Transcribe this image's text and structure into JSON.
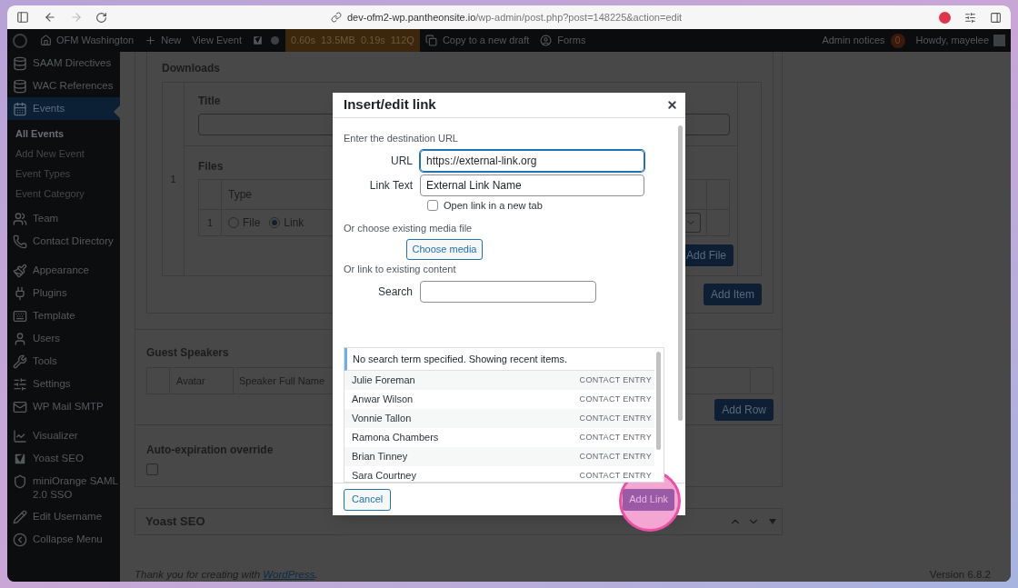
{
  "browser": {
    "url_host": "dev-ofm2-wp.pantheonsite.io",
    "url_path": "/wp-admin/post.php?post=148225&action=edit"
  },
  "admin_bar": {
    "site": "OFM Washington",
    "new": "New",
    "view": "View Event",
    "perf": [
      "0.60s",
      "13.5MB",
      "0.19s",
      "112Q"
    ],
    "copy": "Copy to a new draft",
    "forms": "Forms",
    "notices": {
      "label": "Admin notices",
      "count": "0"
    },
    "howdy": "Howdy, mayelee"
  },
  "sidebar": {
    "groups": [
      [
        {
          "label": "SAAM Directives",
          "selected": false
        },
        {
          "label": "WAC References",
          "selected": false
        },
        {
          "label": "Events",
          "selected": true,
          "children": [
            {
              "label": "All Events",
              "selected": true
            },
            {
              "label": "Add New Event",
              "selected": false
            },
            {
              "label": "Event Types",
              "selected": false
            },
            {
              "label": "Event Category",
              "selected": false
            }
          ]
        },
        {
          "label": "Team",
          "selected": false
        },
        {
          "label": "Contact Directory",
          "selected": false
        }
      ],
      [
        {
          "label": "Appearance",
          "selected": false
        },
        {
          "label": "Plugins",
          "selected": false
        },
        {
          "label": "Template",
          "selected": false
        },
        {
          "label": "Users",
          "selected": false
        },
        {
          "label": "Tools",
          "selected": false
        },
        {
          "label": "Settings",
          "selected": false
        },
        {
          "label": "WP Mail SMTP",
          "selected": false
        }
      ],
      [
        {
          "label": "Visualizer",
          "selected": false
        },
        {
          "label": "Yoast SEO",
          "selected": false
        },
        {
          "label": "miniOrange SAML 2.0 SSO",
          "selected": false
        },
        {
          "label": "Edit Username",
          "selected": false
        },
        {
          "label": "Collapse Menu",
          "selected": false
        }
      ]
    ]
  },
  "downloads": {
    "title": "Downloads",
    "row_number": "1",
    "title_label": "Title",
    "files_label": "Files",
    "files_column": "Type",
    "files_row_number": "1",
    "file_types": [
      {
        "label": "File",
        "selected": false
      },
      {
        "label": "Link",
        "selected": true
      }
    ],
    "add_file": "Add File",
    "add_item": "Add Item"
  },
  "guest_speakers": {
    "title": "Guest Speakers",
    "columns": [
      "Avatar",
      "Speaker Full Name"
    ],
    "add_row": "Add Row"
  },
  "auto_expiration": {
    "label": "Auto-expiration override",
    "checked": false
  },
  "yoast_box": {
    "title": "Yoast SEO"
  },
  "footer": {
    "thanks": "Thank you for creating with ",
    "link": "WordPress",
    "after": ".",
    "version": "Version 6.8.2"
  },
  "dialog": {
    "title": "Insert/edit link",
    "intro": "Enter the destination URL",
    "url": {
      "label": "URL",
      "value": "https://external-link.org"
    },
    "link_text": {
      "label": "Link Text",
      "value": "External Link Name"
    },
    "new_tab": {
      "label": "Open link in a new tab",
      "checked": false
    },
    "media_heading": "Or choose existing media file",
    "choose_media": "Choose media",
    "content_heading": "Or link to existing content",
    "search": {
      "label": "Search"
    },
    "notice": "No search term specified. Showing recent items.",
    "results": [
      {
        "title": "Julie Foreman",
        "type": "CONTACT ENTRY"
      },
      {
        "title": "Anwar Wilson",
        "type": "CONTACT ENTRY"
      },
      {
        "title": "Vonnie Tallon",
        "type": "CONTACT ENTRY"
      },
      {
        "title": "Ramona Chambers",
        "type": "CONTACT ENTRY"
      },
      {
        "title": "Brian Tinney",
        "type": "CONTACT ENTRY"
      },
      {
        "title": "Sara Courtney",
        "type": "CONTACT ENTRY"
      }
    ],
    "cancel": "Cancel",
    "add_link": "Add Link"
  }
}
